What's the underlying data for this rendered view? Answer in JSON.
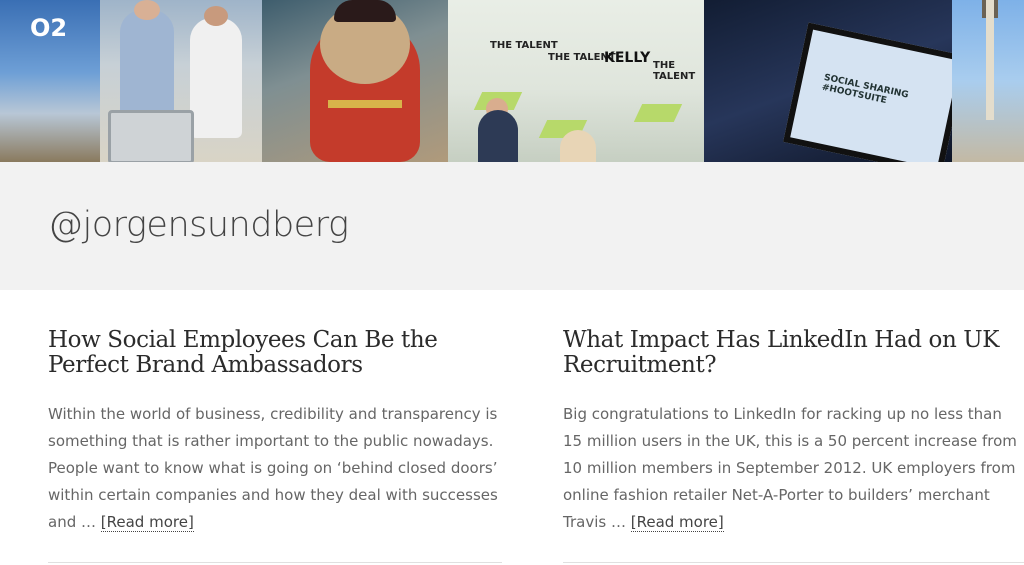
{
  "banner": {
    "o2_logo": "O2",
    "talent_words": [
      "THE TALENT",
      "THE TALENT",
      "THE TALENT"
    ],
    "kelly_logo": "KELLY",
    "screen_text": "SOCIAL SHARING #HOOTSUITE"
  },
  "header": {
    "title": "@jorgensundberg"
  },
  "posts": [
    {
      "title": "How Social Employees Can Be the Perfect Brand Ambassadors",
      "excerpt": "Within the world of business, credibility and transparency is something that is rather important to the public nowadays. People want to know what is going on ‘behind closed doors’ within certain companies and how they deal with successes and …",
      "read_more": "[Read more]"
    },
    {
      "title": "What Impact Has LinkedIn Had on UK Recruitment?",
      "excerpt": "Big congratulations to LinkedIn for racking up no less than 15 million users in the UK, this is a 50 percent increase from 10 million members in September 2012. UK employers from online fashion retailer Net-A-Porter to builders’ merchant Travis …",
      "read_more": "[Read more]"
    }
  ]
}
